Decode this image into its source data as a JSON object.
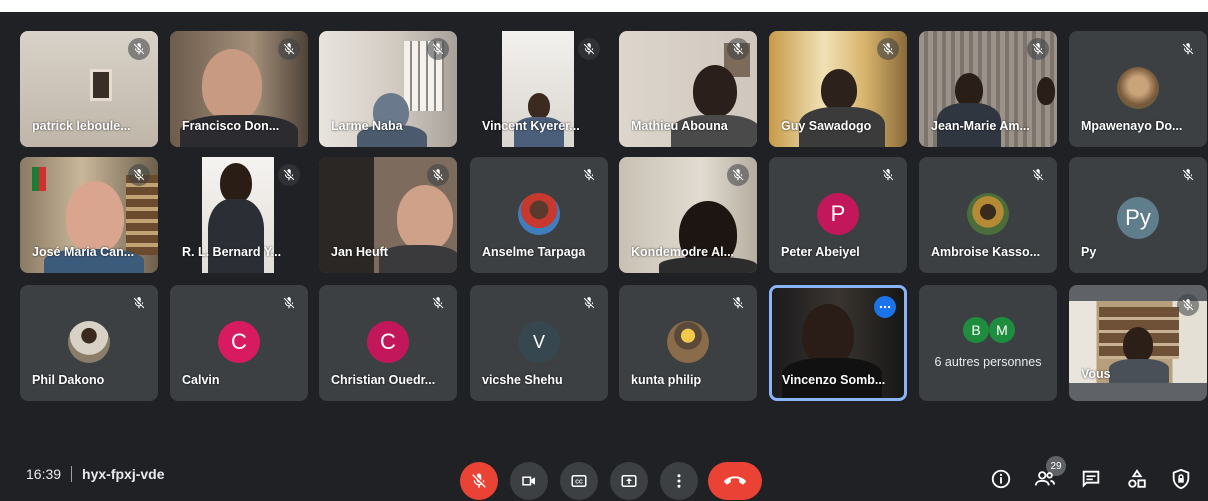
{
  "participants": [
    {
      "name": "patrick leboule...",
      "type": "video"
    },
    {
      "name": "Francisco Don...",
      "type": "video"
    },
    {
      "name": "Larme Naba",
      "type": "video"
    },
    {
      "name": "Vincent Kyerer...",
      "type": "video"
    },
    {
      "name": "Mathieu Abouna",
      "type": "video"
    },
    {
      "name": "Guy Sawadogo",
      "type": "video"
    },
    {
      "name": "Jean-Marie Am...",
      "type": "video"
    },
    {
      "name": "Mpawenayo Do...",
      "type": "photo"
    },
    {
      "name": "José Maria Can...",
      "type": "video"
    },
    {
      "name": "R. L. Bernard Y...",
      "type": "video"
    },
    {
      "name": "Jan Heuft",
      "type": "video"
    },
    {
      "name": "Anselme Tarpaga",
      "type": "photo"
    },
    {
      "name": "Kondemodre Al...",
      "type": "video"
    },
    {
      "name": "Peter Abeiyel",
      "type": "letter",
      "initial": "P",
      "color": "#c2185b"
    },
    {
      "name": "Ambroise Kasso...",
      "type": "photo"
    },
    {
      "name": "Py",
      "type": "letter",
      "initial": "Py",
      "color": "#607d8b"
    },
    {
      "name": "Phil Dakono",
      "type": "photo"
    },
    {
      "name": "Calvin",
      "type": "letter",
      "initial": "C",
      "color": "#d81b60"
    },
    {
      "name": "Christian Ouedr...",
      "type": "letter",
      "initial": "C",
      "color": "#c2185b"
    },
    {
      "name": "vicshe Shehu",
      "type": "letter",
      "initial": "V",
      "color": "#37474f"
    },
    {
      "name": "kunta philip",
      "type": "photo"
    },
    {
      "name": "Vincenzo Somb...",
      "type": "video",
      "active": true
    },
    {
      "name": "6 autres personnes",
      "type": "others",
      "initials": [
        "B",
        "M"
      ]
    },
    {
      "name": "Vous",
      "type": "video"
    }
  ],
  "bottom_bar": {
    "time": "16:39",
    "meeting_code": "hyx-fpxj-vde",
    "people_count": "29"
  },
  "icons": {
    "mic_off": "mic-off-icon",
    "camera": "videocam-icon",
    "captions": "closed-captions-icon",
    "present": "present-screen-icon",
    "more": "more-options-icon",
    "hangup": "hang-up-icon",
    "info": "info-icon",
    "people": "people-icon",
    "chat": "chat-icon",
    "activities": "activities-icon",
    "host_controls": "host-controls-icon"
  },
  "colors": {
    "background": "#202124",
    "tile": "#3c4043",
    "danger": "#ea4335",
    "active_border": "#8ab4f8",
    "avatar_b": "#1e8e3e",
    "avatar_m": "#1e8e3e"
  }
}
